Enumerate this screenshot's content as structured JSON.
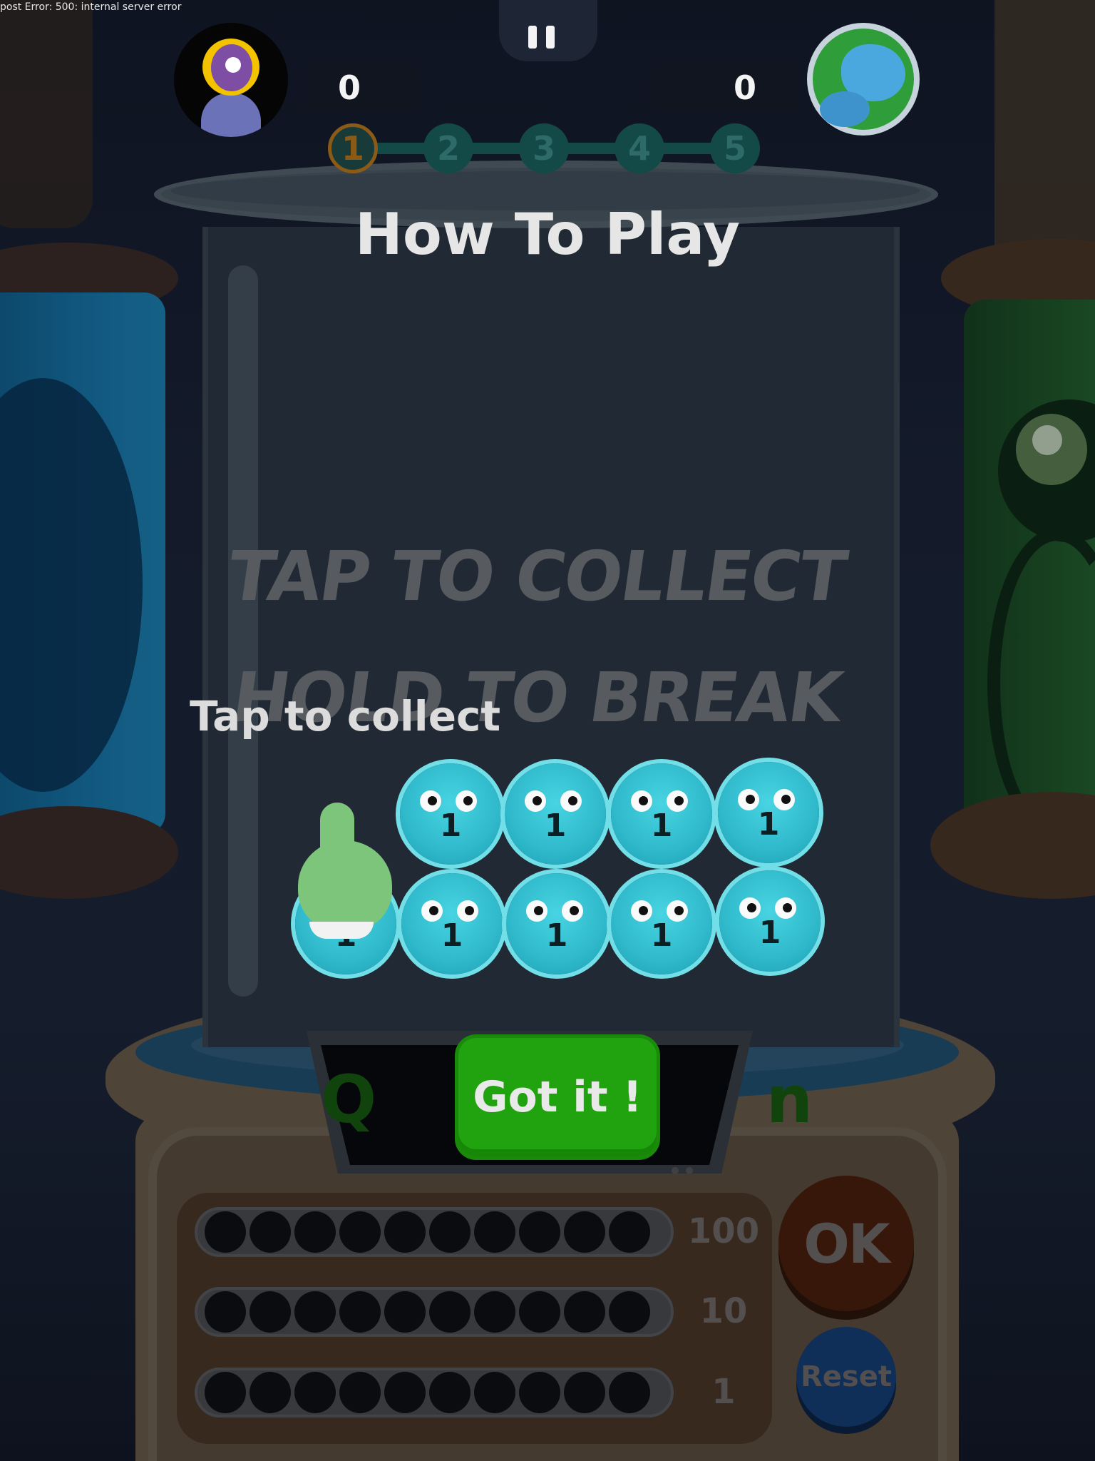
{
  "error_text": "post Error: 500: internal server error",
  "hud": {
    "player_score": "0",
    "opponent_score": "0",
    "stages": [
      "1",
      "2",
      "3",
      "4",
      "5"
    ],
    "current_stage": 1,
    "player_avatar_icon": "purple-one-eyed-character-avatar",
    "opponent_avatar_icon": "earth-globe-icon",
    "pause_icon": "pause-icon"
  },
  "tutorial": {
    "title": "How To Play",
    "ghost_line_1": "TAP TO COLLECT",
    "ghost_line_2": "HOLD TO BREAK",
    "hint": "Tap to collect",
    "bubble_value": "1",
    "got_it_label": "Got it !"
  },
  "machine": {
    "screen_text": "Q                n",
    "rows": [
      {
        "value": "100",
        "dots": 10
      },
      {
        "value": "10",
        "dots": 10
      },
      {
        "value": "1",
        "dots": 10
      }
    ],
    "ok_label": "OK",
    "reset_label": "Reset"
  },
  "colors": {
    "got_it_green": "#20a30e",
    "bubble_cyan": "#2fb9cb",
    "ok_brown": "#4a1d06",
    "reset_blue": "#123d72",
    "finger_green": "#7ec57c"
  }
}
